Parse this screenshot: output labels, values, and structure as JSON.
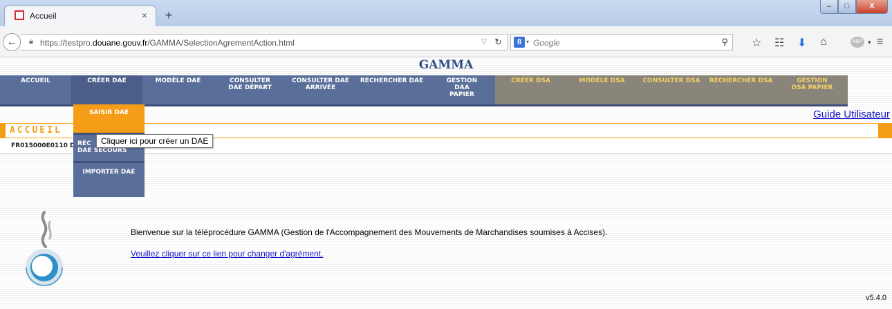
{
  "browser": {
    "tab_title": "Accueil",
    "tab_close": "×",
    "new_tab": "+",
    "url_prefix": "https://testpro.",
    "url_domain": "douane.gouv.fr",
    "url_path": "/GAMMA/SelectionAgrementAction.html",
    "search_engine_letter": "8",
    "search_placeholder": "Google",
    "window_min": "–",
    "window_max": "□",
    "window_close": "X",
    "abp_label": "ABP"
  },
  "app": {
    "name": "GAMMA",
    "menu": [
      {
        "label": "ACCUEIL",
        "group": "dae"
      },
      {
        "label": "CRÉER DAE",
        "group": "dae",
        "active": true
      },
      {
        "label": "MODÈLE DAE",
        "group": "dae"
      },
      {
        "label": "CONSULTER DAE DÉPART",
        "group": "dae"
      },
      {
        "label": "CONSULTER DAE ARRIVÉE",
        "group": "dae"
      },
      {
        "label": "RECHERCHER DAE",
        "group": "dae"
      },
      {
        "label": "GESTION DAA PAPIER",
        "group": "dae"
      },
      {
        "label": "CRÉER DSA",
        "group": "dsa"
      },
      {
        "label": "MODÈLE DSA",
        "group": "dsa"
      },
      {
        "label": "CONSULTER DSA",
        "group": "dsa"
      },
      {
        "label": "RECHERCHER DSA",
        "group": "dsa"
      },
      {
        "label": "GESTION DSA PAPIER",
        "group": "dsa"
      }
    ],
    "submenu": {
      "saisir": "SAISIR DAE",
      "recup_line1": "RÉC",
      "recup_line2": "DAE SECOURS",
      "importer": "IMPORTER DAE"
    },
    "tooltip": "Cliquer ici pour créer un DAE",
    "guide_link": "Guide Utilisateur",
    "section_title": "ACCUEIL",
    "agrement_code": "FR015000E0110 D",
    "welcome_text": "Bienvenue sur la téléprocédure GAMMA (Gestion de l'Accompagnement des Mouvements de Marchandises soumises à Accises).",
    "change_link": "Veuillez cliquer sur ce lien pour changer d'agrément.",
    "version": "v5.4.0"
  },
  "colors": {
    "menu_dae": "#5a6e9a",
    "menu_dsa": "#8a857a",
    "accent_orange": "#f59d16",
    "link_blue": "#1515c8",
    "title_blue": "#2d4f86"
  }
}
